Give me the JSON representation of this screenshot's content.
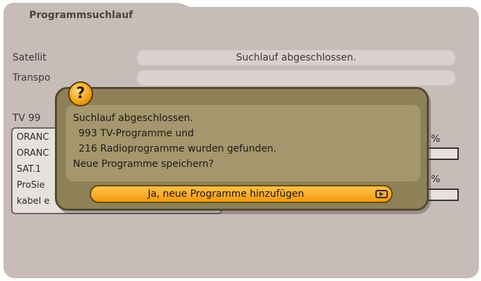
{
  "window": {
    "title": "Programmsuchlauf"
  },
  "fields": {
    "satellit_label": "Satellit",
    "satellit_value": "Suchlauf abgeschlossen.",
    "transponder_label": "Transpo"
  },
  "tv_count_label": "TV 99",
  "channel_list": [
    "ORANC",
    "ORANC",
    "SAT.1",
    "ProSie",
    "kabel e"
  ],
  "percent_symbols": [
    "%",
    "%"
  ],
  "dialog": {
    "icon": "question-icon",
    "icon_glyph": "?",
    "lines": [
      "Suchlauf abgeschlossen.",
      "993 TV-Programme und",
      "216 Radioprogramme wurden gefunden.",
      "Neue Programme speichern?"
    ],
    "button_label": "Ja, neue Programme hinzufügen",
    "button_icon": "play-icon"
  },
  "colors": {
    "background": "#c7bcb8",
    "dialog": "#8e8158",
    "button": "#f7a823"
  }
}
